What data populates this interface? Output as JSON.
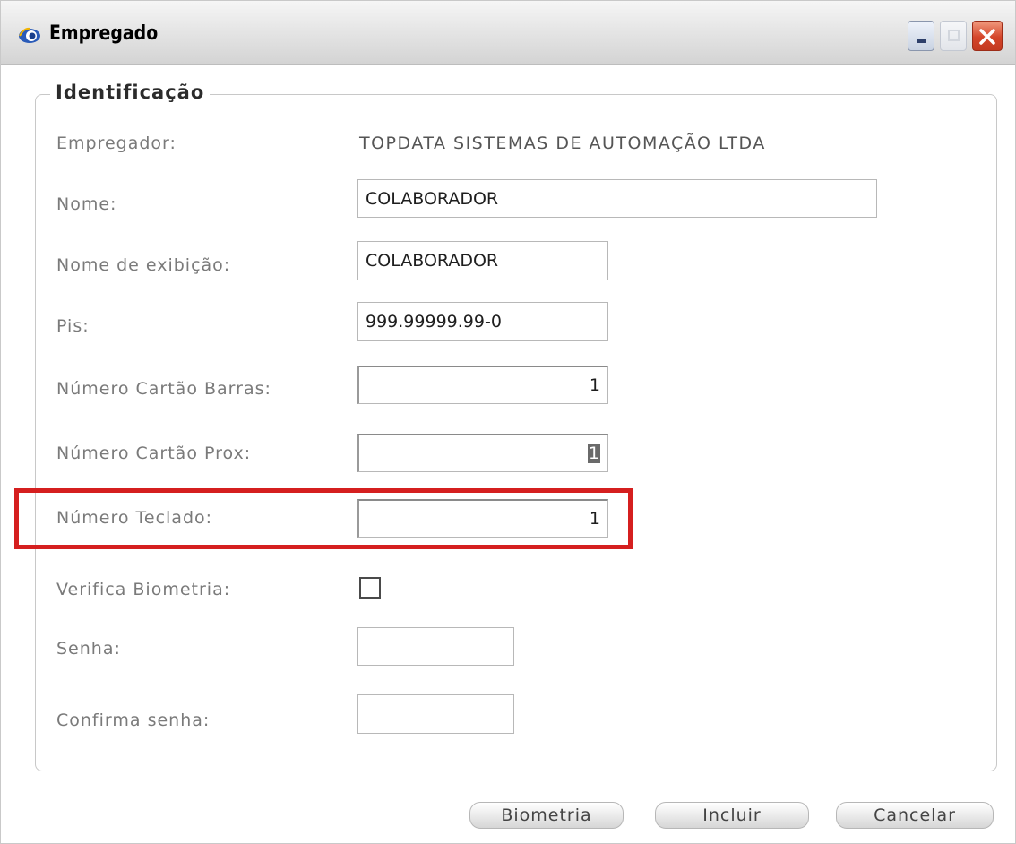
{
  "window": {
    "title": "Empregado",
    "icons": {
      "app": "app-eye-icon",
      "minimize": "minimize-icon",
      "maximize": "maximize-icon",
      "close": "close-icon"
    }
  },
  "group": {
    "title": "Identificação"
  },
  "form": {
    "employer_label": "Empregador:",
    "employer_value": "TOPDATA SISTEMAS DE AUTOMAÇÃO LTDA",
    "name_label": "Nome:",
    "name_value": "COLABORADOR",
    "display_name_label": "Nome de exibição:",
    "display_name_value": "COLABORADOR",
    "pis_label": "Pis:",
    "pis_value": "999.99999.99-0",
    "barcode_card_label": "Número Cartão Barras:",
    "barcode_card_value": "1",
    "prox_card_label": "Número Cartão Prox:",
    "prox_card_value": "1",
    "keypad_number_label": "Número Teclado:",
    "keypad_number_value": "1",
    "verify_biometrics_label": "Verifica Biometria:",
    "verify_biometrics_checked": false,
    "password_label": "Senha:",
    "password_value": "",
    "confirm_password_label": "Confirma senha:",
    "confirm_password_value": ""
  },
  "buttons": {
    "biometrics": "Biometria",
    "include": "Incluir",
    "cancel": "Cancelar"
  },
  "colors": {
    "highlight": "#d51f1f",
    "close_button": "#d4452a",
    "label_text": "#7a7a7a"
  }
}
